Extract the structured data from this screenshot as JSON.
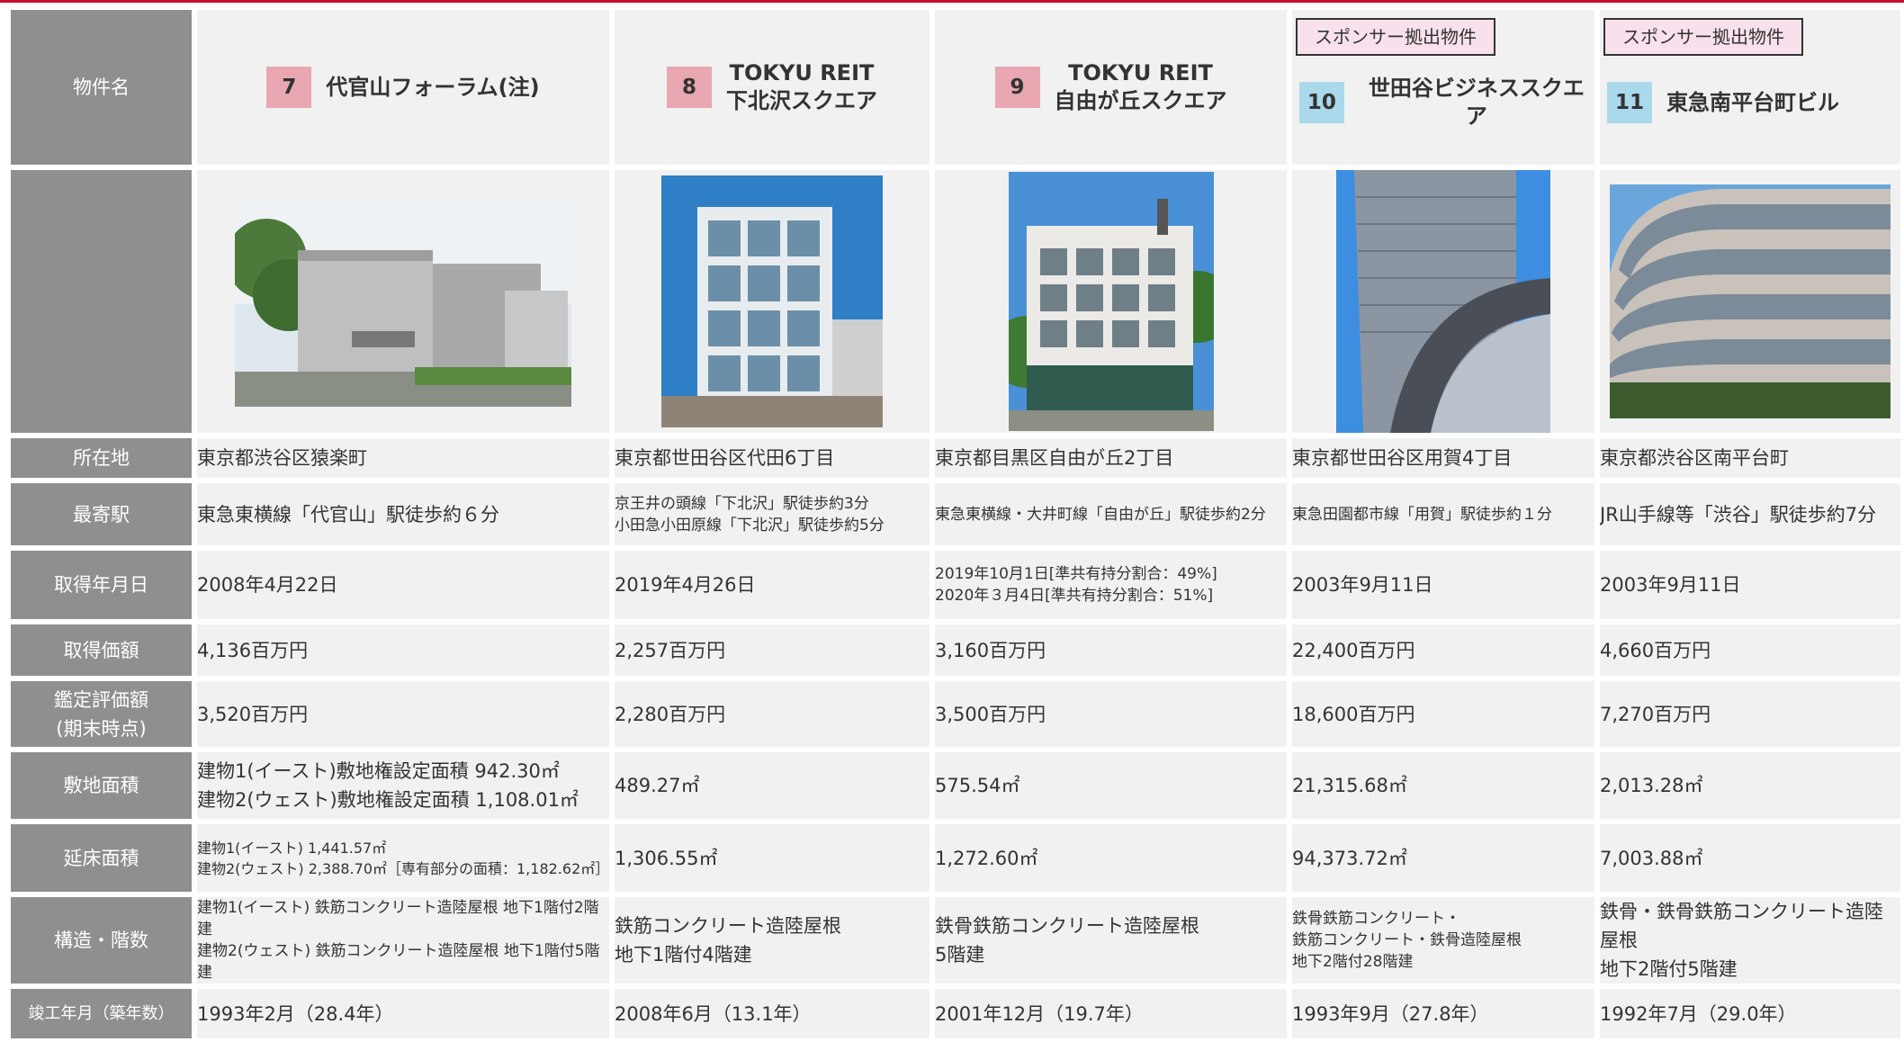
{
  "header_label": "物件名",
  "row_labels": {
    "location": "所在地",
    "station": "最寄駅",
    "acquired": "取得年月日",
    "price": "取得価額",
    "appraisal_line1": "鑑定評価額",
    "appraisal_line2": "(期末時点)",
    "land": "敷地面積",
    "floor": "延床面積",
    "structure": "構造・階数",
    "completed": "竣工年月（築年数）"
  },
  "sponsor_label": "スポンサー拠出物件",
  "properties": [
    {
      "num": "7",
      "badge_color": "#e8a7b1",
      "name_line1": "代官山フォーラム(注)",
      "name_line2": "",
      "sponsor": "",
      "location": "東京都渋谷区猿楽町",
      "station_line1": "東急東横線「代官山」駅徒歩約６分",
      "station_line2": "",
      "acquired_line1": "2008年4月22日",
      "acquired_line2": "",
      "price": "4,136百万円",
      "appraisal": "3,520百万円",
      "land_line1": "建物1(イースト)敷地権設定面積 942.30㎡",
      "land_line2": "建物2(ウェスト)敷地権設定面積 1,108.01㎡",
      "floor_line1": "建物1(イースト) 1,441.57㎡",
      "floor_line2": "建物2(ウェスト) 2,388.70㎡［専有部分の面積：1,182.62㎡］",
      "structure_line1": "建物1(イースト) 鉄筋コンクリート造陸屋根 地下1階付2階建",
      "structure_line2": "建物2(ウェスト) 鉄筋コンクリート造陸屋根 地下1階付5階建",
      "structure_line3": "",
      "completed": "1993年2月（28.4年）"
    },
    {
      "num": "8",
      "badge_color": "#e8a7b1",
      "name_line1": "TOKYU REIT",
      "name_line2": "下北沢スクエア",
      "sponsor": "",
      "location": "東京都世田谷区代田6丁目",
      "station_line1": "京王井の頭線「下北沢」駅徒歩約3分",
      "station_line2": "小田急小田原線「下北沢」駅徒歩約5分",
      "acquired_line1": "2019年4月26日",
      "acquired_line2": "",
      "price": "2,257百万円",
      "appraisal": "2,280百万円",
      "land_line1": "489.27㎡",
      "land_line2": "",
      "floor_line1": "1,306.55㎡",
      "floor_line2": "",
      "structure_line1": "鉄筋コンクリート造陸屋根",
      "structure_line2": "地下1階付4階建",
      "structure_line3": "",
      "completed": "2008年6月（13.1年）"
    },
    {
      "num": "9",
      "badge_color": "#e8a7b1",
      "name_line1": "TOKYU REIT",
      "name_line2": "自由が丘スクエア",
      "sponsor": "",
      "location": "東京都目黒区自由が丘2丁目",
      "station_line1": "東急東横線・大井町線「自由が丘」駅徒歩約2分",
      "station_line2": "",
      "acquired_line1": "2019年10月1日[準共有持分割合：49%]",
      "acquired_line2": "2020年３月4日[準共有持分割合：51%]",
      "price": "3,160百万円",
      "appraisal": "3,500百万円",
      "land_line1": "575.54㎡",
      "land_line2": "",
      "floor_line1": "1,272.60㎡",
      "floor_line2": "",
      "structure_line1": "鉄骨鉄筋コンクリート造陸屋根",
      "structure_line2": "5階建",
      "structure_line3": "",
      "completed": "2001年12月（19.7年）"
    },
    {
      "num": "10",
      "badge_color": "#a9d9ea",
      "name_line1": "世田谷ビジネススクエア",
      "name_line2": "",
      "sponsor": "スポンサー拠出物件",
      "location": "東京都世田谷区用賀4丁目",
      "station_line1": "東急田園都市線「用賀」駅徒歩約１分",
      "station_line2": "",
      "acquired_line1": "2003年9月11日",
      "acquired_line2": "",
      "price": "22,400百万円",
      "appraisal": "18,600百万円",
      "land_line1": "21,315.68㎡",
      "land_line2": "",
      "floor_line1": "94,373.72㎡",
      "floor_line2": "",
      "structure_line1": "鉄骨鉄筋コンクリート・",
      "structure_line2": "鉄筋コンクリート・鉄骨造陸屋根",
      "structure_line3": "地下2階付28階建",
      "completed": "1993年9月（27.8年）"
    },
    {
      "num": "11",
      "badge_color": "#a9d9ea",
      "name_line1": "東急南平台町ビル",
      "name_line2": "",
      "sponsor": "スポンサー拠出物件",
      "location": "東京都渋谷区南平台町",
      "station_line1": "JR山手線等「渋谷」駅徒歩約7分",
      "station_line2": "",
      "acquired_line1": "2003年9月11日",
      "acquired_line2": "",
      "price": "4,660百万円",
      "appraisal": "7,270百万円",
      "land_line1": "2,013.28㎡",
      "land_line2": "",
      "floor_line1": "7,003.88㎡",
      "floor_line2": "",
      "structure_line1": "鉄骨・鉄骨鉄筋コンクリート造陸屋根",
      "structure_line2": "地下2階付5階建",
      "structure_line3": "",
      "completed": "1992年7月（29.0年）"
    }
  ]
}
